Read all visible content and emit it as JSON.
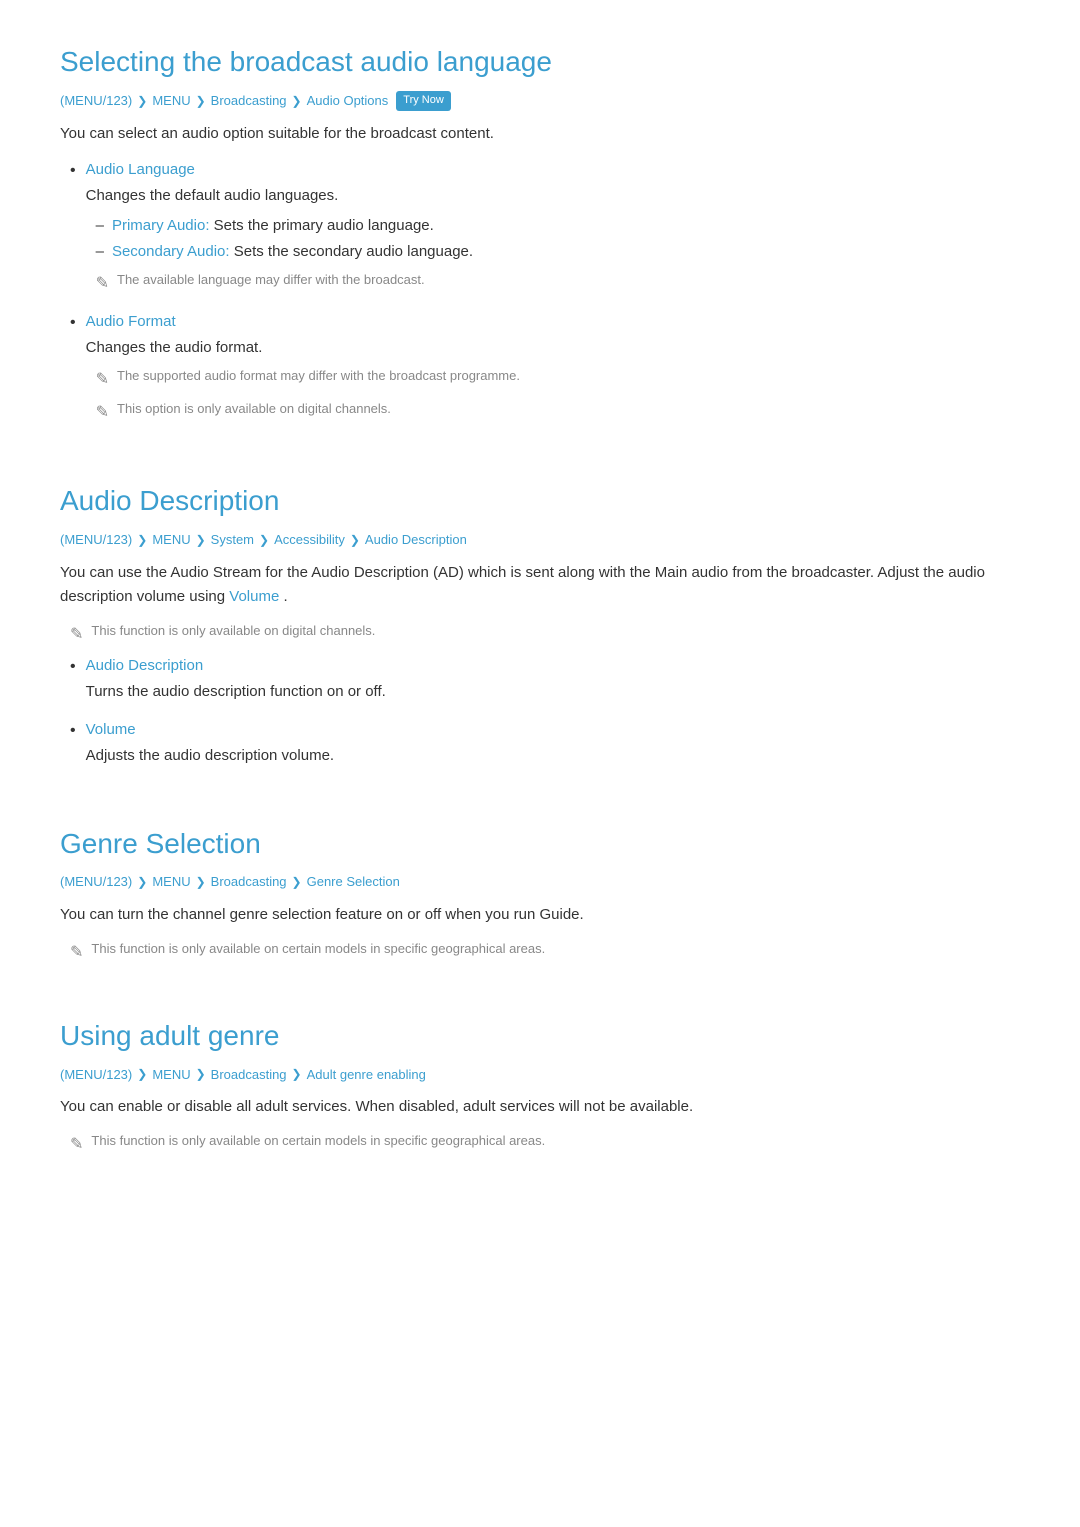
{
  "sections": [
    {
      "id": "broadcast-audio",
      "title": "Selecting the broadcast audio language",
      "breadcrumb": [
        {
          "text": "(MENU/123)"
        },
        {
          "text": "MENU"
        },
        {
          "text": "Broadcasting"
        },
        {
          "text": "Audio Options"
        }
      ],
      "try_now": true,
      "try_now_label": "Try Now",
      "body": "You can select an audio option suitable for the broadcast content.",
      "bullets": [
        {
          "label": "Audio Language",
          "desc": "Changes the default audio languages.",
          "sub_items": [
            {
              "label": "Primary Audio:",
              "text": " Sets the primary audio language."
            },
            {
              "label": "Secondary Audio:",
              "text": " Sets the secondary audio language."
            }
          ],
          "notes": [
            {
              "text": "The available language may differ with the broadcast."
            }
          ]
        },
        {
          "label": "Audio Format",
          "desc": "Changes the audio format.",
          "sub_items": [],
          "notes": [
            {
              "text": "The supported audio format may differ with the broadcast programme."
            },
            {
              "text": "This option is only available on digital channels."
            }
          ]
        }
      ]
    },
    {
      "id": "audio-description",
      "title": "Audio Description",
      "breadcrumb": [
        {
          "text": "(MENU/123)"
        },
        {
          "text": "MENU"
        },
        {
          "text": "System"
        },
        {
          "text": "Accessibility"
        },
        {
          "text": "Audio Description"
        }
      ],
      "try_now": false,
      "body": "You can use the Audio Stream for the Audio Description (AD) which is sent along with the Main audio from the broadcaster. Adjust the audio description volume using",
      "body_link": "Volume",
      "body_suffix": ".",
      "top_notes": [
        {
          "text": "This function is only available on digital channels."
        }
      ],
      "bullets": [
        {
          "label": "Audio Description",
          "desc": "Turns the audio description function on or off.",
          "sub_items": [],
          "notes": []
        },
        {
          "label": "Volume",
          "desc": "Adjusts the audio description volume.",
          "sub_items": [],
          "notes": []
        }
      ]
    },
    {
      "id": "genre-selection",
      "title": "Genre Selection",
      "breadcrumb": [
        {
          "text": "(MENU/123)"
        },
        {
          "text": "MENU"
        },
        {
          "text": "Broadcasting"
        },
        {
          "text": "Genre Selection"
        }
      ],
      "try_now": false,
      "body": "You can turn the channel genre selection feature on or off when you run Guide.",
      "top_notes": [],
      "bullets": [],
      "notes": [
        {
          "text": "This function is only available on certain models in specific geographical areas."
        }
      ]
    },
    {
      "id": "adult-genre",
      "title": "Using adult genre",
      "breadcrumb": [
        {
          "text": "(MENU/123)"
        },
        {
          "text": "MENU"
        },
        {
          "text": "Broadcasting"
        },
        {
          "text": "Adult genre enabling"
        }
      ],
      "try_now": false,
      "body": "You can enable or disable all adult services. When disabled, adult services will not be available.",
      "top_notes": [],
      "bullets": [],
      "notes": [
        {
          "text": "This function is only available on certain models in specific geographical areas."
        }
      ]
    }
  ],
  "icons": {
    "pencil": "✎",
    "bullet_dot": "•",
    "dash": "–",
    "chevron": "❯"
  }
}
